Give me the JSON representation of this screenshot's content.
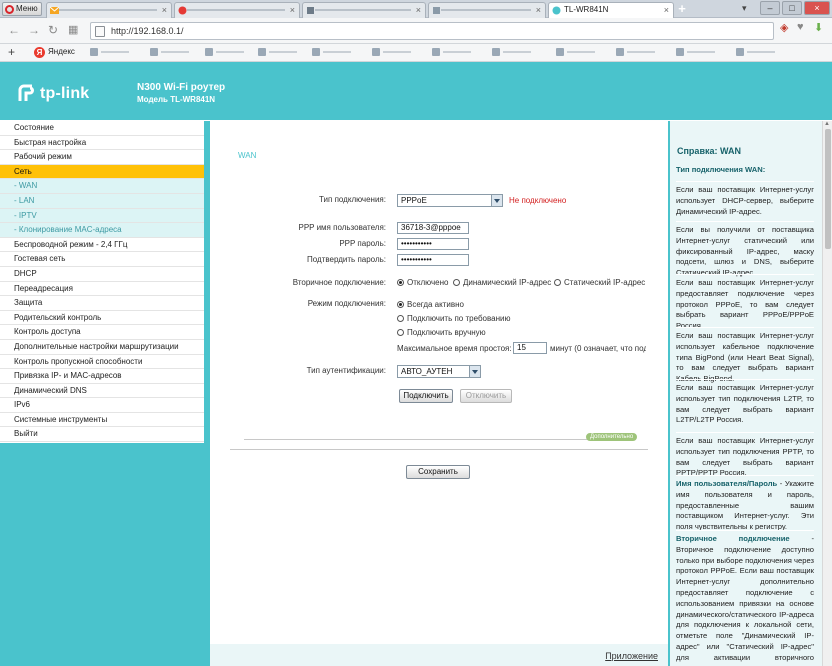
{
  "browser": {
    "menu_label": "Меню",
    "tabs": [
      {
        "label": "",
        "active": false
      },
      {
        "label": "",
        "active": false
      },
      {
        "label": "",
        "active": false
      },
      {
        "label": "TL-WR841N",
        "active": true
      }
    ],
    "url": "http://192.168.0.1/",
    "bookmark_yandex": "Яндекс"
  },
  "router": {
    "brand": "tp-link",
    "product_name": "N300 Wi-Fi роутер",
    "model": "Модель TL-WR841N"
  },
  "sidebar": {
    "items": [
      {
        "label": "Состояние",
        "state": "normal"
      },
      {
        "label": "Быстрая настройка",
        "state": "normal"
      },
      {
        "label": "Рабочий режим",
        "state": "normal"
      },
      {
        "label": "Сеть",
        "state": "active"
      },
      {
        "label": "- WAN",
        "state": "sub"
      },
      {
        "label": "- LAN",
        "state": "sub"
      },
      {
        "label": "- IPTV",
        "state": "sub"
      },
      {
        "label": "- Клонирование MAC-адреса",
        "state": "sub"
      },
      {
        "label": "Беспроводной режим - 2,4 ГГц",
        "state": "normal"
      },
      {
        "label": "Гостевая сеть",
        "state": "normal"
      },
      {
        "label": "DHCP",
        "state": "normal"
      },
      {
        "label": "Переадресация",
        "state": "normal"
      },
      {
        "label": "Защита",
        "state": "normal"
      },
      {
        "label": "Родительский контроль",
        "state": "normal"
      },
      {
        "label": "Контроль доступа",
        "state": "normal"
      },
      {
        "label": "Дополнительные настройки маршрутизации",
        "state": "normal"
      },
      {
        "label": "Контроль пропускной способности",
        "state": "normal"
      },
      {
        "label": "Привязка IP- и MAC-адресов",
        "state": "normal"
      },
      {
        "label": "Динамический DNS",
        "state": "normal"
      },
      {
        "label": "IPv6",
        "state": "normal"
      },
      {
        "label": "Системные инструменты",
        "state": "normal"
      },
      {
        "label": "Выйти",
        "state": "normal"
      }
    ]
  },
  "wan": {
    "section_title": "WAN",
    "conn_type_label": "Тип подключения:",
    "conn_type_value": "PPPoE",
    "conn_status": "Не подключено",
    "ppp_user_label": "PPP имя пользователя:",
    "ppp_user_value": "36718-3@pppoe",
    "ppp_pass_label": "PPP пароль:",
    "ppp_pass_value": "•••••••••••",
    "ppp_confirm_label": "Подтвердить пароль:",
    "ppp_confirm_value": "•••••••••••",
    "secondary_label": "Вторичное подключение:",
    "secondary_options": [
      "Отключено",
      "Динамический IP-адрес",
      "Статический IP-адрес"
    ],
    "mode_label": "Режим подключения:",
    "mode_options": [
      "Всегда активно",
      "Подключить по требованию",
      "Подключить вручную"
    ],
    "idle_label": "Максимальное время простоя:",
    "idle_value": "15",
    "idle_hint": "минут (0 означает, что под",
    "auth_label": "Тип аутентификации:",
    "auth_value": "АВТО_АУТЕН",
    "connect_btn": "Подключить",
    "disconnect_btn": "Отключить",
    "advanced_label": "Дополнительно",
    "save_btn": "Сохранить",
    "app_link": "Приложение"
  },
  "help": {
    "title": "Справка: WAN",
    "blocks": [
      {
        "bold": "Тип подключения WAN:",
        "text": ""
      },
      {
        "bold": "",
        "text": "Если ваш поставщик Интернет-услуг использует DHCP-сервер, выберите Динамический IP-адрес."
      },
      {
        "bold": "",
        "text": "Если вы получили от поставщика Интернет-услуг статический или фиксированный IP-адрес, маску подсети, шлюз и DNS, выберите Статический IP-адрес."
      },
      {
        "bold": "",
        "text": "Если ваш поставщик Интернет-услуг предоставляет подключение через протокол PPPoE, то вам следует выбрать вариант PPPoE/PPPoE Россия."
      },
      {
        "bold": "",
        "text": "Если ваш поставщик Интернет-услуг использует кабельное подключение типа BigPond (или Heart Beat Signal), то вам следует выбрать вариант Кабель BigPond."
      },
      {
        "bold": "",
        "text": "Если ваш поставщик Интернет-услуг использует тип подключения L2TP, то вам следует выбрать вариант L2TP/L2TP Россия."
      },
      {
        "bold": "",
        "text": "Если ваш поставщик Интернет-услуг использует тип подключения PPTP, то вам следует выбрать вариант PPTP/PPTP Россия."
      },
      {
        "bold": "Имя пользователя/Пароль",
        "text": " - Укажите имя пользователя и пароль, предоставленные вашим поставщиком Интернет-услуг. Эти поля чувствительны к регистру."
      },
      {
        "bold": "Вторичное подключение",
        "text": " - Вторичное подключение доступно только при выборе подключения через протокол PPPoE. Если ваш поставщик Интернет-услуг дополнительно предоставляет подключение с использованием привязки на основе динамического/статического IP-адреса для подключения к локальной сети, отметьте поле \"Динамический IP-адрес\" или \"Статический IP-адрес\" для активации вторичного подключения."
      }
    ]
  },
  "colors": {
    "brand": "#4ac3cc",
    "active_menu": "#ffc108",
    "status_red": "#d32020"
  }
}
